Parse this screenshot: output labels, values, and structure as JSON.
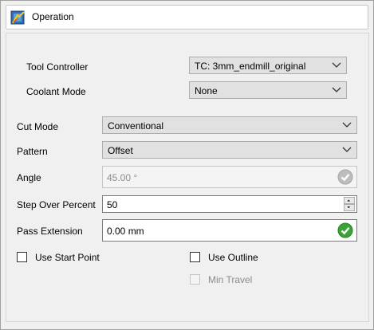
{
  "header": {
    "title": "Operation",
    "icon": "operation-icon"
  },
  "tool_controller": {
    "label": "Tool Controller",
    "value": "TC: 3mm_endmill_original"
  },
  "coolant_mode": {
    "label": "Coolant Mode",
    "value": "None"
  },
  "cut_mode": {
    "label": "Cut Mode",
    "value": "Conventional"
  },
  "pattern": {
    "label": "Pattern",
    "value": "Offset"
  },
  "angle": {
    "label": "Angle",
    "value": "45.00 °",
    "enabled": false
  },
  "step_over": {
    "label": "Step Over Percent",
    "value": "50"
  },
  "pass_extension": {
    "label": "Pass Extension",
    "value": "0.00 mm"
  },
  "use_start_point": {
    "label": "Use Start Point",
    "checked": false
  },
  "use_outline": {
    "label": "Use Outline",
    "checked": false
  },
  "min_travel": {
    "label": "Min Travel",
    "checked": false,
    "enabled": false
  },
  "colors": {
    "valid_green": "#3aa335",
    "disabled_grey": "#8c8c8c"
  }
}
